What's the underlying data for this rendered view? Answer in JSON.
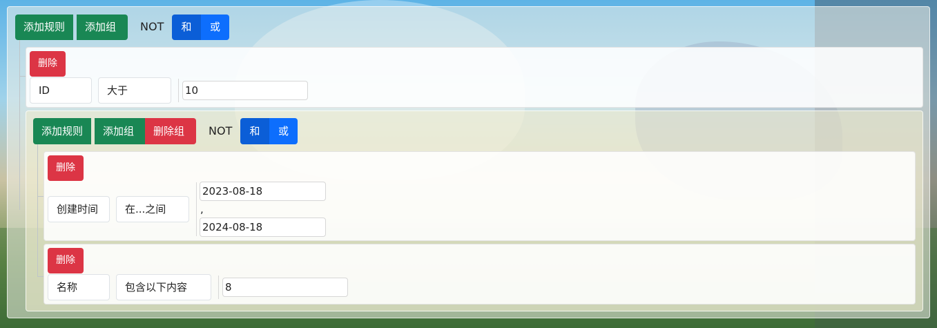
{
  "root": {
    "add_rule": "添加规则",
    "add_group": "添加组",
    "not_label": "NOT",
    "and_label": "和",
    "or_label": "或"
  },
  "rule1": {
    "delete": "删除",
    "field": "ID",
    "operator": "大于",
    "value": "10"
  },
  "group": {
    "add_rule": "添加规则",
    "add_group": "添加组",
    "delete_group": "删除组",
    "not_label": "NOT",
    "and_label": "和",
    "or_label": "或",
    "rule_a": {
      "delete": "删除",
      "field": "创建时间",
      "operator": "在...之间",
      "value_from": "2023-08-18",
      "separator": ",",
      "value_to": "2024-08-18"
    },
    "rule_b": {
      "delete": "删除",
      "field": "名称",
      "operator": "包含以下内容",
      "value": "8"
    }
  },
  "colors": {
    "success": "#198754",
    "danger": "#dc3545",
    "primary": "#0d6efd",
    "primary_active": "#0b5ed7"
  }
}
